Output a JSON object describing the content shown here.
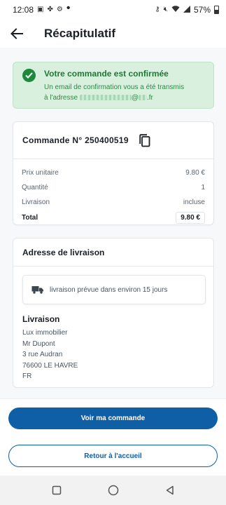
{
  "status_bar": {
    "time": "12:08",
    "battery": "57%"
  },
  "header": {
    "title": "Récapitulatif"
  },
  "confirmation": {
    "title": "Votre commande est confirmée",
    "line1": "Un email de confirmation vous a été transmis",
    "line2_prefix": "à l'adresse",
    "line2_at": "@",
    "line2_suffix": ".fr"
  },
  "order": {
    "number_label": "Commande N° 250400519",
    "rows": [
      {
        "label": "Prix unitaire",
        "value": "9.80 €"
      },
      {
        "label": "Quantité",
        "value": "1"
      },
      {
        "label": "Livraison",
        "value": "incluse"
      }
    ],
    "total_label": "Total",
    "total_value": "9.80 €"
  },
  "address": {
    "section_title": "Adresse de livraison",
    "delivery_note": "livraison prévue dans environ 15 jours",
    "block_title": "Livraison",
    "lines": [
      "Lux immobilier",
      "Mr Dupont",
      "3 rue Audran",
      "76600 LE HAVRE",
      "FR"
    ]
  },
  "buttons": {
    "view_order": "Voir ma commande",
    "back_home": "Retour à l'accueil"
  },
  "colors": {
    "primary": "#0f5fa6",
    "success_bg": "#d9f0de",
    "success_text": "#1c7a34"
  },
  "icons": {
    "back": "arrow-left-icon",
    "copy": "copy-icon",
    "check": "check-circle-icon",
    "truck": "truck-icon"
  }
}
